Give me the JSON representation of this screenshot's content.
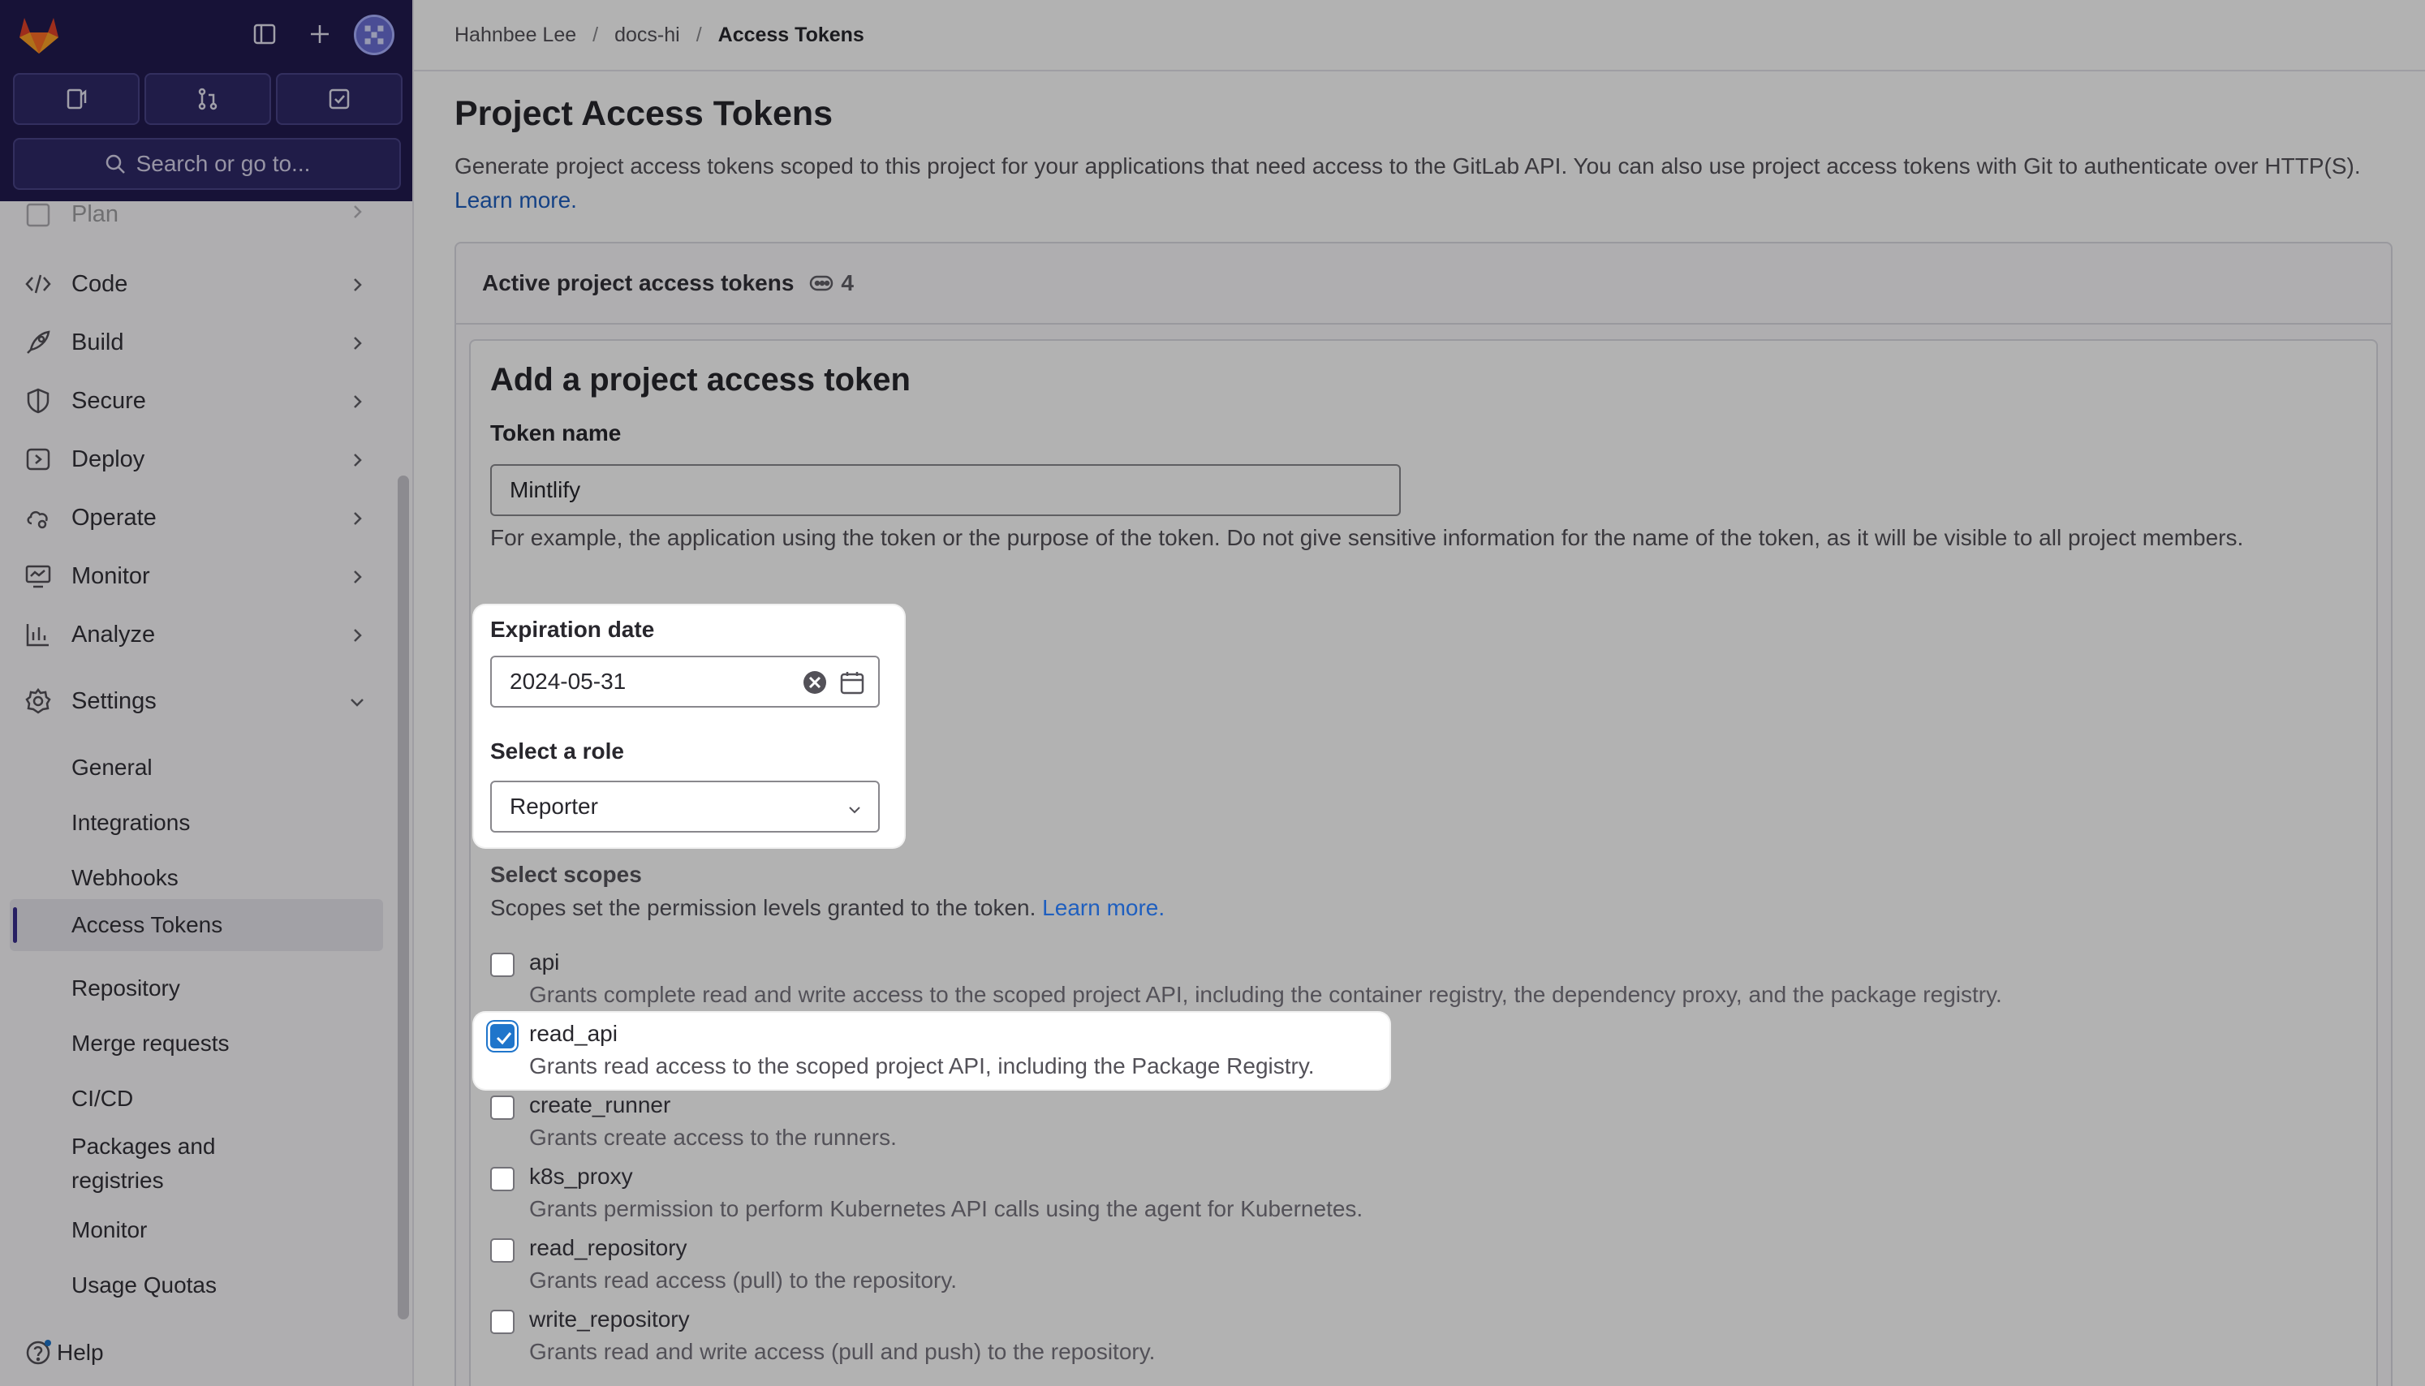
{
  "sidebar": {
    "search_placeholder": "Search or go to...",
    "nav": [
      {
        "label": "Plan",
        "icon": "plan-icon"
      },
      {
        "label": "Code",
        "icon": "code-icon"
      },
      {
        "label": "Build",
        "icon": "rocket-icon"
      },
      {
        "label": "Secure",
        "icon": "shield-icon"
      },
      {
        "label": "Deploy",
        "icon": "deploy-icon"
      },
      {
        "label": "Operate",
        "icon": "cloud-gear-icon"
      },
      {
        "label": "Monitor",
        "icon": "monitor-icon"
      },
      {
        "label": "Analyze",
        "icon": "chart-icon"
      },
      {
        "label": "Settings",
        "icon": "gear-icon"
      }
    ],
    "settings_items": [
      {
        "label": "General"
      },
      {
        "label": "Integrations"
      },
      {
        "label": "Webhooks"
      },
      {
        "label": "Access Tokens",
        "active": true
      },
      {
        "label": "Repository"
      },
      {
        "label": "Merge requests"
      },
      {
        "label": "CI/CD"
      },
      {
        "label": "Packages and registries"
      },
      {
        "label": "Monitor"
      },
      {
        "label": "Usage Quotas"
      }
    ],
    "help_label": "Help"
  },
  "breadcrumb": [
    "Hahnbee Lee",
    "docs-hi",
    "Access Tokens"
  ],
  "page": {
    "title": "Project Access Tokens",
    "description": "Generate project access tokens scoped to this project for your applications that need access to the GitLab API. You can also use project access tokens with Git to authenticate over HTTP(S).",
    "learn_more": "Learn more."
  },
  "active_tokens": {
    "label": "Active project access tokens",
    "count": "4"
  },
  "form": {
    "title": "Add a project access token",
    "token_name_label": "Token name",
    "token_name_value": "Mintlify",
    "token_name_help": "For example, the application using the token or the purpose of the token. Do not give sensitive information for the name of the token, as it will be visible to all project members.",
    "expiration_label": "Expiration date",
    "expiration_value": "2024-05-31",
    "role_label": "Select a role",
    "role_value": "Reporter",
    "scopes_label": "Select scopes",
    "scopes_help": "Scopes set the permission levels granted to the token.",
    "scopes_learn_more": "Learn more.",
    "scopes": [
      {
        "name": "api",
        "desc": "Grants complete read and write access to the scoped project API, including the container registry, the dependency proxy, and the package registry.",
        "checked": false
      },
      {
        "name": "read_api",
        "desc": "Grants read access to the scoped project API, including the Package Registry.",
        "checked": true
      },
      {
        "name": "create_runner",
        "desc": "Grants create access to the runners.",
        "checked": false
      },
      {
        "name": "k8s_proxy",
        "desc": "Grants permission to perform Kubernetes API calls using the agent for Kubernetes.",
        "checked": false
      },
      {
        "name": "read_repository",
        "desc": "Grants read access (pull) to the repository.",
        "checked": false
      },
      {
        "name": "write_repository",
        "desc": "Grants read and write access (pull and push) to the repository.",
        "checked": false
      }
    ]
  },
  "colors": {
    "sidebar_top": "#211b4f",
    "link": "#1f5fbf",
    "checkbox": "#1f75cb"
  }
}
